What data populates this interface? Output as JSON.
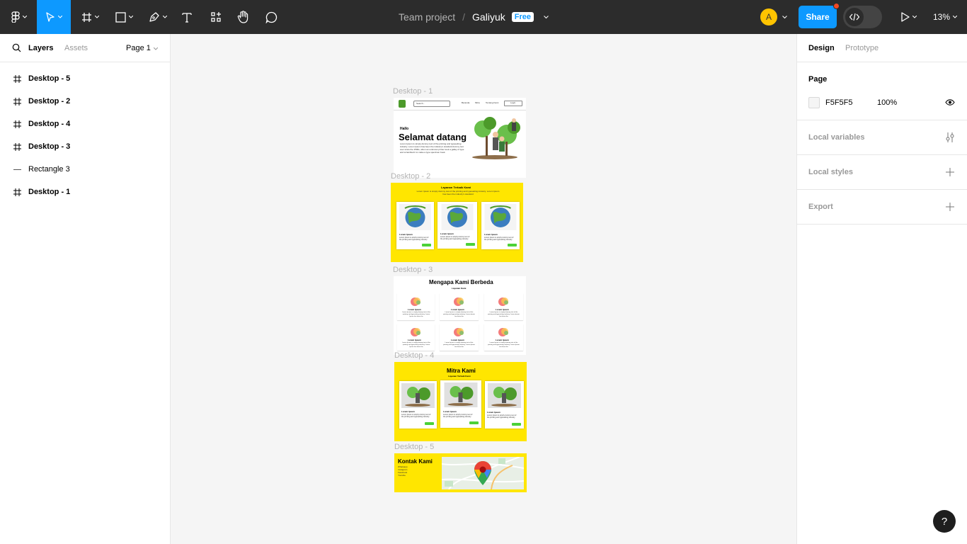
{
  "toolbar": {
    "project": "Team project",
    "file": "Galiyuk",
    "plan_badge": "Free",
    "share_label": "Share",
    "avatar_initial": "A",
    "zoom": "13%",
    "accent_color": "#0d99ff"
  },
  "left_panel": {
    "tabs": [
      "Layers",
      "Assets"
    ],
    "page_selector": "Page 1",
    "layers": [
      {
        "name": "Desktop - 5",
        "icon": "frame-icon"
      },
      {
        "name": "Desktop - 2",
        "icon": "frame-icon"
      },
      {
        "name": "Desktop - 4",
        "icon": "frame-icon"
      },
      {
        "name": "Desktop - 3",
        "icon": "frame-icon"
      },
      {
        "name": "Rectangle 3",
        "icon": "line-icon"
      },
      {
        "name": "Desktop - 1",
        "icon": "frame-icon"
      }
    ]
  },
  "right_panel": {
    "tabs": [
      "Design",
      "Prototype"
    ],
    "page_heading": "Page",
    "page_color": "F5F5F5",
    "page_opacity": "100%",
    "sections": [
      "Local variables",
      "Local styles",
      "Export"
    ]
  },
  "canvas": {
    "frames": {
      "d1": {
        "label": "Desktop - 1",
        "search": "Search...",
        "nav": [
          "Beranda",
          "Mitra",
          "Tentang Kami"
        ],
        "login": "Login",
        "hello": "Hallo",
        "heading": "Selamat datang",
        "body": "Lorem Ipsum is simply dummy text of the printing and typesetting industry. Lorem Ipsum has been the industry's standard dummy text ever since the 1500s, when an unknown printer took a galley of type and scrambled it to make a type specimen book."
      },
      "d2": {
        "label": "Desktop - 2",
        "title": "Layanan Terbaik Kami",
        "subtitle": "Lorem Ipsum is simply dummy text of the printing and typesetting industry. Lorem Ipsum has been the industry's standard",
        "cards": [
          {
            "title": "Lorem Ipsum",
            "text": "Lorem Ipsum is simply dummy text of the printing and typesetting industry"
          },
          {
            "title": "Lorem Ipsum",
            "text": "Lorem Ipsum is simply dummy text of the printing and typesetting industry"
          },
          {
            "title": "Lorem Ipsum",
            "text": "Lorem Ipsum is simply dummy text of the printing and typesetting industry"
          }
        ]
      },
      "d3": {
        "label": "Desktop - 3",
        "title": "Mengapa Kami Berbeda",
        "subtitle": "Layanan Kami",
        "items": [
          {
            "title": "Lorem Ipsum",
            "text": "Lorem Ipsum is simply dummy text of the printing and typesetting industry. Lorem Ipsum has been the"
          },
          {
            "title": "Lorem Ipsum",
            "text": "Lorem Ipsum is simply dummy text of the printing and typesetting industry. Lorem Ipsum has been the"
          },
          {
            "title": "Lorem Ipsum",
            "text": "Lorem Ipsum is simply dummy text of the printing and typesetting industry. Lorem Ipsum has been the"
          },
          {
            "title": "Lorem Ipsum",
            "text": "Lorem Ipsum is simply dummy text of the printing and typesetting industry. Lorem Ipsum has been the"
          },
          {
            "title": "Lorem Ipsum",
            "text": "Lorem Ipsum is simply dummy text of the printing and typesetting industry. Lorem Ipsum has been the"
          },
          {
            "title": "Lorem Ipsum",
            "text": "Lorem Ipsum is simply dummy text of the printing and typesetting industry. Lorem Ipsum has been the"
          }
        ]
      },
      "d4": {
        "label": "Desktop - 4",
        "title": "Mitra Kami",
        "subtitle": "Layanan Terbaik Kami",
        "cards": [
          {
            "title": "Lorem Ipsum",
            "text": "Lorem Ipsum is simply dummy text of the printing and typesetting industry"
          },
          {
            "title": "Lorem Ipsum",
            "text": "Lorem Ipsum is simply dummy text of the printing and typesetting industry"
          },
          {
            "title": "Lorem Ipsum",
            "text": "Lorem Ipsum is simply dummy text of the printing and typesetting industry"
          }
        ]
      },
      "d5": {
        "label": "Desktop - 5",
        "title": "Kontak Kami",
        "links": [
          "Whatsapp",
          "Instagram",
          "Facebook",
          "Youtube"
        ]
      }
    },
    "frame_color_yellow": "#ffe600"
  }
}
